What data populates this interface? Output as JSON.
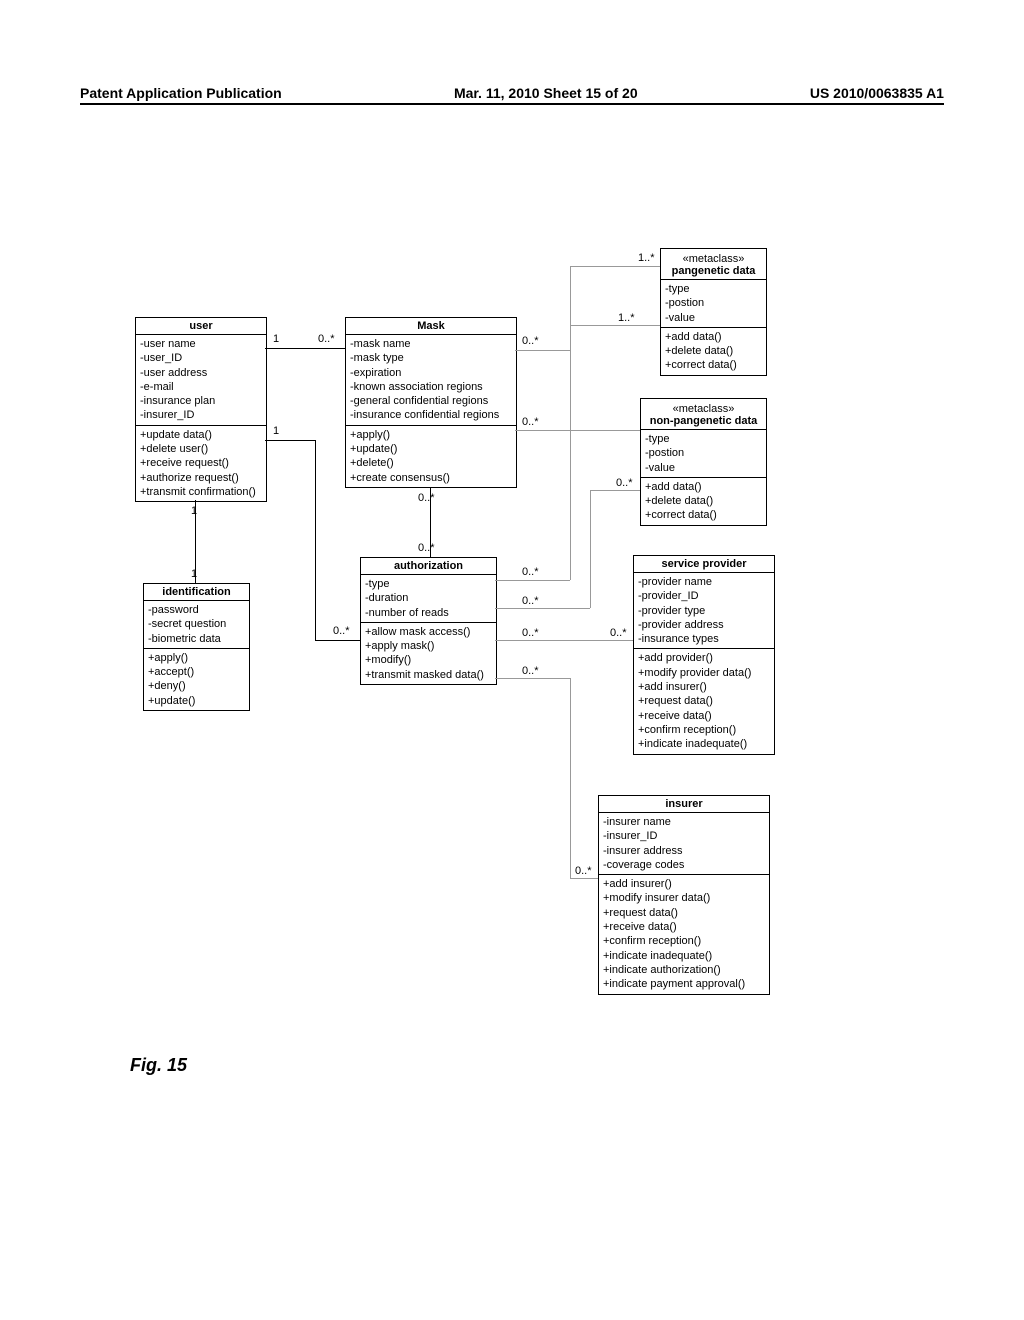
{
  "header": {
    "left": "Patent Application Publication",
    "center": "Mar. 11, 2010  Sheet 15 of 20",
    "right": "US 2010/0063835 A1"
  },
  "figure_label": "Fig. 15",
  "classes": {
    "user": {
      "title": "user",
      "attrs": [
        "-user name",
        "-user_ID",
        "-user address",
        "-e-mail",
        "-insurance plan",
        "-insurer_ID"
      ],
      "ops": [
        "+update data()",
        "+delete user()",
        "+receive request()",
        "+authorize request()",
        "+transmit confirmation()"
      ]
    },
    "mask": {
      "title": "Mask",
      "attrs": [
        "-mask name",
        "-mask type",
        "-expiration",
        "-known association regions",
        "-general confidential regions",
        "-insurance confidential regions"
      ],
      "ops": [
        "+apply()",
        "+update()",
        "+delete()",
        "+create consensus()"
      ]
    },
    "identification": {
      "title": "identification",
      "attrs": [
        "-password",
        "-secret question",
        "-biometric data"
      ],
      "ops": [
        "+apply()",
        "+accept()",
        "+deny()",
        "+update()"
      ]
    },
    "authorization": {
      "title": "authorization",
      "attrs": [
        "-type",
        "-duration",
        "-number of reads"
      ],
      "ops": [
        "+allow mask access()",
        "+apply mask()",
        "+modify()",
        "+transmit masked data()"
      ]
    },
    "pangenetic": {
      "stereo": "«metaclass»",
      "title": "pangenetic data",
      "attrs": [
        "-type",
        "-postion",
        "-value"
      ],
      "ops": [
        "+add data()",
        "+delete data()",
        "+correct data()"
      ]
    },
    "nonpangenetic": {
      "stereo": "«metaclass»",
      "title": "non-pangenetic data",
      "attrs": [
        "-type",
        "-postion",
        "-value"
      ],
      "ops": [
        "+add data()",
        "+delete data()",
        "+correct data()"
      ]
    },
    "serviceprovider": {
      "title": "service provider",
      "attrs": [
        "-provider name",
        "-provider_ID",
        "-provider type",
        "-provider address",
        "-insurance types"
      ],
      "ops": [
        "+add provider()",
        "+modify provider data()",
        "+add insurer()",
        "+request data()",
        "+receive data()",
        "+confirm reception()",
        "+indicate inadequate()"
      ]
    },
    "insurer": {
      "title": "insurer",
      "attrs": [
        "-insurer name",
        "-insurer_ID",
        "-insurer address",
        "-coverage codes"
      ],
      "ops": [
        "+add insurer()",
        "+modify insurer data()",
        "+request data()",
        "+receive data()",
        "+confirm reception()",
        "+indicate inadequate()",
        "+indicate authorization()",
        "+indicate payment approval()"
      ]
    }
  },
  "mults": {
    "user_mask_left": "1",
    "user_mask_right": "0..*",
    "user_id_top": "1",
    "user_id_bottom": "1",
    "user_auth_left": "1",
    "user_auth_right": "0..*",
    "mask_auth_top": "0..*",
    "mask_auth_bottom": "0..*",
    "mask_pan_left": "0..*",
    "mask_pan_right": "1..*",
    "mask_nonpan_left": "0..*",
    "mask_nonpan_right": "1..*",
    "auth_pan": "0..*",
    "auth_nonpan_left": "0..*",
    "auth_nonpan_right": "0..*",
    "auth_sp_left": "0..*",
    "auth_sp_right": "0..*",
    "auth_ins_left": "0..*",
    "auth_ins_right": "0..*"
  }
}
